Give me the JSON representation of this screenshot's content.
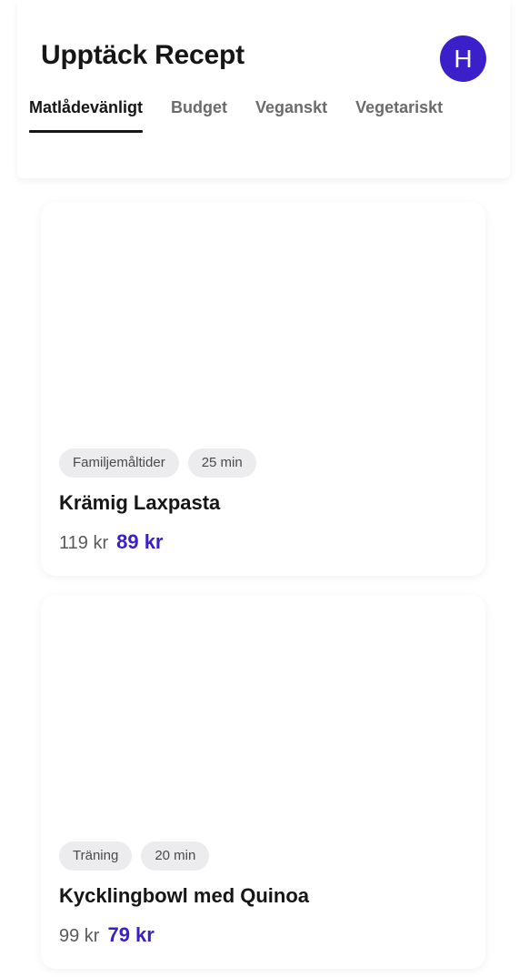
{
  "header": {
    "title": "Upptäck Recept",
    "avatar_initial": "H",
    "accent_color": "#3b20c9"
  },
  "tabs": [
    {
      "label": "Matlådevänligt",
      "active": true
    },
    {
      "label": "Budget",
      "active": false
    },
    {
      "label": "Veganskt",
      "active": false
    },
    {
      "label": "Vegetariskt",
      "active": false
    }
  ],
  "recipes": [
    {
      "tags": [
        "Familjemåltider",
        "25 min"
      ],
      "name": "Krämig Laxpasta",
      "old_price": "119 kr",
      "new_price": "89 kr"
    },
    {
      "tags": [
        "Träning",
        "20 min"
      ],
      "name": "Kycklingbowl med Quinoa",
      "old_price": "99 kr",
      "new_price": "79 kr"
    }
  ]
}
